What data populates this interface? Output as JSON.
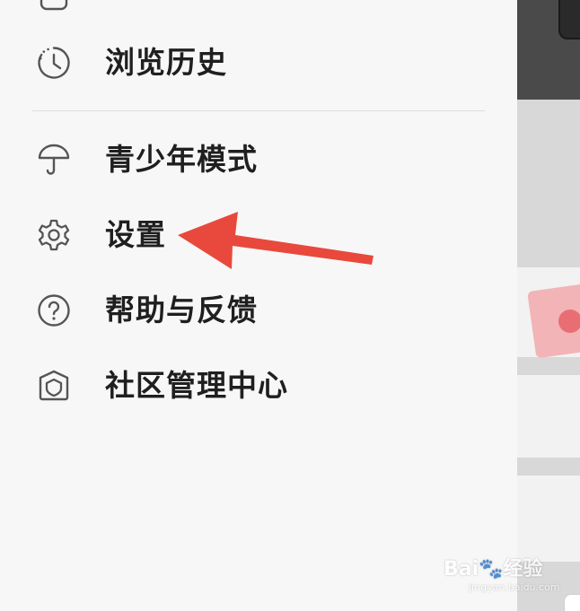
{
  "drawer": {
    "items": [
      {
        "label": "浏览历史",
        "icon": "history-icon"
      },
      {
        "label": "青少年模式",
        "icon": "umbrella-icon"
      },
      {
        "label": "设置",
        "icon": "gear-icon"
      },
      {
        "label": "帮助与反馈",
        "icon": "help-icon"
      },
      {
        "label": "社区管理中心",
        "icon": "shield-home-icon"
      }
    ]
  },
  "annotation": {
    "arrow_color": "#e8493c"
  },
  "watermark": {
    "main": "Bai🐾经验",
    "sub": "jingyan.baidu.com"
  },
  "colors": {
    "drawer_bg": "#f7f7f7",
    "label_text": "#1f1f1f",
    "icon_stroke": "#555555",
    "divider": "#dedede"
  }
}
